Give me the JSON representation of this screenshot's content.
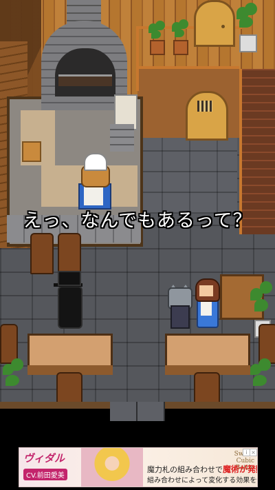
{
  "dialogue": {
    "text": "えっ、なんでもあるって？"
  },
  "ad": {
    "title": "ヴィダル",
    "cv": "CV.前田愛美",
    "logo": "Sword Cubic Battle",
    "line1_before": "魔力札の組み合わせで",
    "line1_highlight": "魔術が発動！",
    "line2": "組み合わせによって変化する効果を使い分けよう！",
    "info_icon": "info-icon",
    "close_icon": "close-icon"
  },
  "colors": {
    "wood": "#b5762f",
    "floor": "#55575c",
    "accent_pink": "#c3246b"
  }
}
